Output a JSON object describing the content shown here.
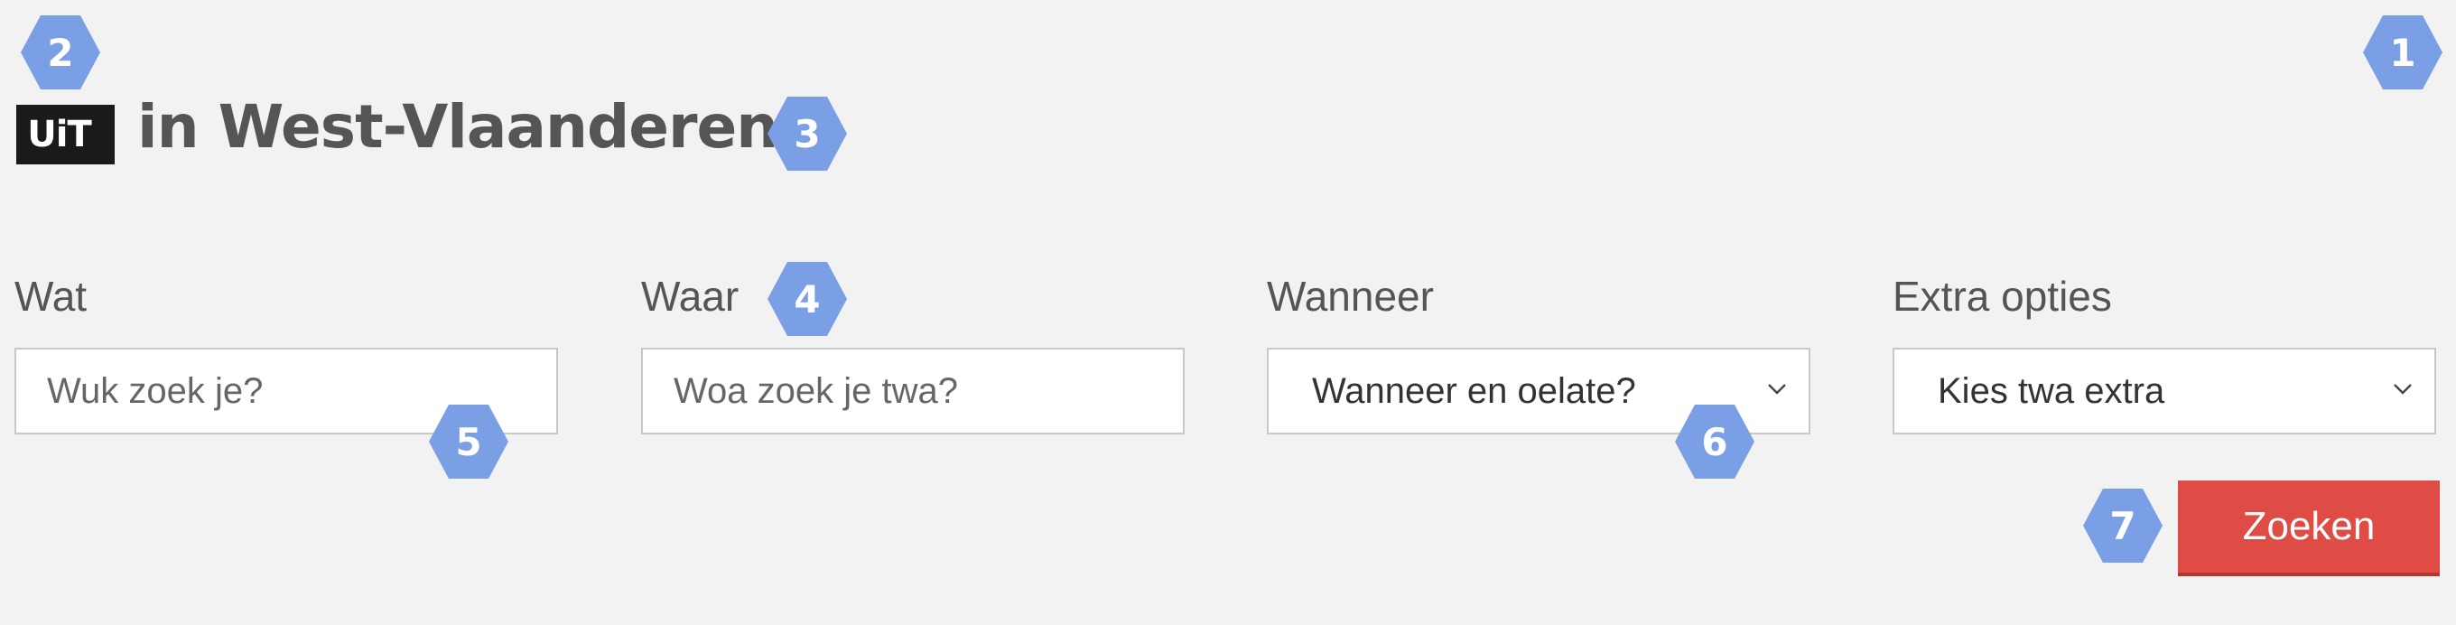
{
  "header": {
    "logo_text": "UiT",
    "title": "in West-Vlaanderen"
  },
  "form": {
    "wat": {
      "label": "Wat",
      "placeholder": "Wuk zoek je?"
    },
    "waar": {
      "label": "Waar",
      "placeholder": "Woa zoek je twa?"
    },
    "wanneer": {
      "label": "Wanneer",
      "value": "Wanneer en oelate?",
      "icon": "chevron-down-icon"
    },
    "extra": {
      "label": "Extra opties",
      "value": "Kies twa extra",
      "icon": "chevron-down-icon"
    },
    "submit_label": "Zoeken"
  },
  "markers": [
    "1",
    "2",
    "3",
    "4",
    "5",
    "6",
    "7"
  ],
  "colors": {
    "background": "#f2f2f2",
    "accent_button": "#df4b45",
    "marker": "#7a9fe4",
    "title_text": "#555555"
  }
}
